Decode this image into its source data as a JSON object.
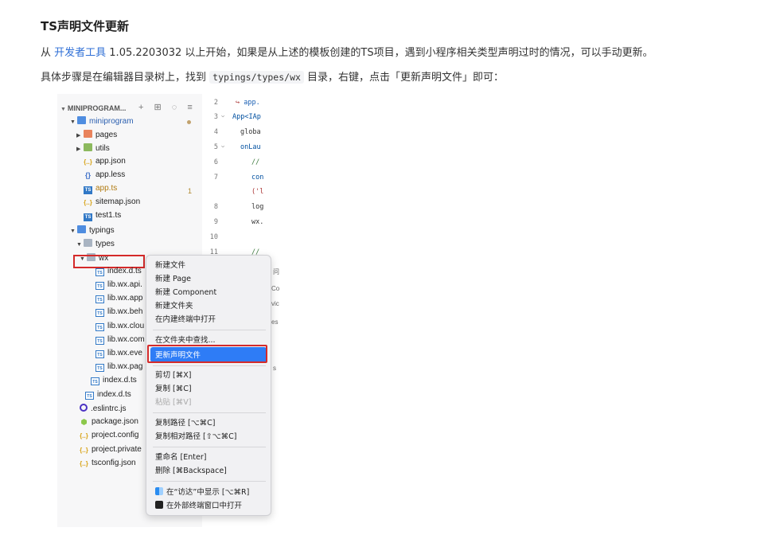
{
  "doc": {
    "title": "TS声明文件更新",
    "para1_prefix": "从 ",
    "para1_link": "开发者工具",
    "para1_rest": " 1.05.2203032 以上开始，如果是从上述的模板创建的TS项目，遇到小程序相关类型声明过时的情况，可以手动更新。",
    "para2_prefix": "具体步骤是在编辑器目录树上，找到 ",
    "para2_code": "typings/types/wx",
    "para2_rest": " 目录，右键，点击「更新声明文件」即可："
  },
  "explorer": {
    "title": "MINIPROGRAM...",
    "header_icons": "+ ⊞ ◌ ≡",
    "items": [
      {
        "label": "miniprogram",
        "arrow": "▼",
        "icon": "folder-blue-icon"
      },
      {
        "label": "pages",
        "arrow": "▶",
        "icon": "folder-icon"
      },
      {
        "label": "utils",
        "arrow": "▶",
        "icon": "folder-icon"
      },
      {
        "label": "app.json",
        "icon": "json-icon"
      },
      {
        "label": "app.less",
        "icon": "less-icon"
      },
      {
        "label": "app.ts",
        "icon": "ts-icon",
        "badge": "1"
      },
      {
        "label": "sitemap.json",
        "icon": "json-icon"
      },
      {
        "label": "test1.ts",
        "icon": "ts-icon"
      },
      {
        "label": "typings",
        "arrow": "▼",
        "icon": "folder-icon"
      },
      {
        "label": "types",
        "arrow": "▼",
        "icon": "folder-icon"
      },
      {
        "label": "wx",
        "arrow": "▼",
        "icon": "folder-icon"
      },
      {
        "label": "index.d.ts",
        "icon": "ts-icon"
      },
      {
        "label": "lib.wx.api.",
        "icon": "ts-icon"
      },
      {
        "label": "lib.wx.app",
        "icon": "ts-icon"
      },
      {
        "label": "lib.wx.beh",
        "icon": "ts-icon"
      },
      {
        "label": "lib.wx.clou",
        "icon": "ts-icon"
      },
      {
        "label": "lib.wx.com",
        "icon": "ts-icon"
      },
      {
        "label": "lib.wx.eve",
        "icon": "ts-icon"
      },
      {
        "label": "lib.wx.pag",
        "icon": "ts-icon"
      },
      {
        "label": "index.d.ts",
        "icon": "ts-icon"
      },
      {
        "label": "index.d.ts",
        "icon": "ts-icon"
      },
      {
        "label": ".eslintrc.js",
        "icon": "eslint-icon"
      },
      {
        "label": "package.json",
        "icon": "package-icon"
      },
      {
        "label": "project.config",
        "icon": "json-icon"
      },
      {
        "label": "project.private",
        "icon": "json-icon"
      },
      {
        "label": "tsconfig.json",
        "icon": "json-icon"
      }
    ]
  },
  "editor": {
    "lines": [
      {
        "num": "2",
        "code": "app."
      },
      {
        "num": "3",
        "code": "App<IAp"
      },
      {
        "num": "4",
        "code": "globa"
      },
      {
        "num": "5",
        "code": "onLau"
      },
      {
        "num": "6",
        "code": "//"
      },
      {
        "num": "7",
        "code": "con"
      },
      {
        "num": "",
        "code": "('l"
      },
      {
        "num": "8",
        "code": "log"
      },
      {
        "num": "9",
        "code": "wx."
      },
      {
        "num": "10",
        "code": ""
      },
      {
        "num": "11",
        "code": "//"
      }
    ],
    "peek": [
      "问",
      "Co",
      "vic",
      "es",
      "s"
    ]
  },
  "context_menu": {
    "items": [
      "新建文件",
      "新建 Page",
      "新建 Component",
      "新建文件夹",
      "在内建终端中打开",
      "在文件夹中查找...",
      "更新声明文件",
      "剪切 [⌘X]",
      "复制 [⌘C]",
      "粘贴 [⌘V]",
      "复制路径 [⌥⌘C]",
      "复制相对路径 [⇧⌥⌘C]",
      "重命名 [Enter]",
      "删除 [⌘Backspace]",
      "在“访达”中显示 [⌥⌘R]",
      "在外部终端窗口中打开"
    ]
  },
  "colors": {
    "link": "#2f6fd6",
    "highlight_border": "#d42a2a",
    "menu_selected": "#2e7cf6"
  }
}
